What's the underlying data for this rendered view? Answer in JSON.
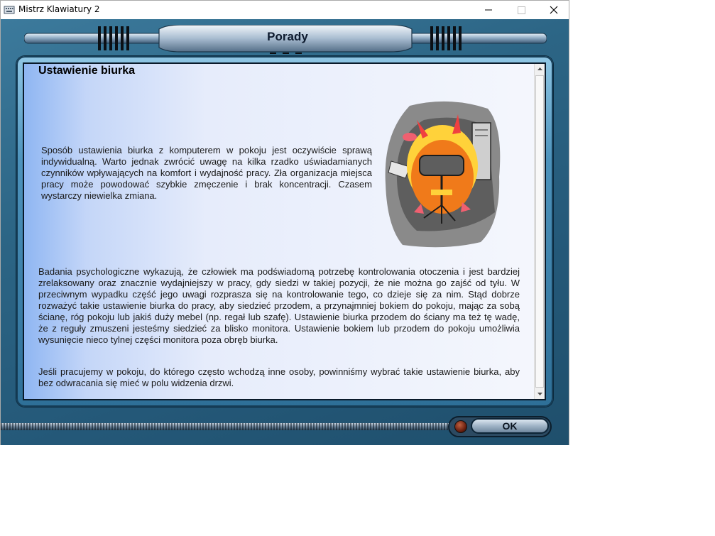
{
  "window": {
    "title": "Mistrz Klawiatury 2"
  },
  "header": {
    "title": "Porady"
  },
  "article": {
    "heading": "Ustawienie biurka",
    "paragraphs": [
      "Sposób ustawienia biurka z komputerem w pokoju jest oczywiście sprawą indywidualną. Warto jednak zwrócić uwagę na kilka rzadko uświadamianych czynników wpływających na komfort i wydajność pracy. Zła organizacja miejsca pracy może powodować szybkie zmęczenie i brak koncentracji. Czasem wystarczy niewielka zmiana.",
      "Badania psychologiczne wykazują, że człowiek ma podświadomą potrzebę kontrolowania otoczenia i jest bardziej zrelaksowany oraz znacznie wydajniejszy w pracy, gdy siedzi w takiej pozycji, że nie można go zajść od tyłu. W przeciwnym wypadku część jego uwagi rozprasza się na kontrolowanie tego, co dzieje się za nim. Stąd dobrze rozważyć takie ustawienie biurka do pracy, aby siedzieć przodem, a przynajmniej bokiem do pokoju, mając za sobą ścianę, róg pokoju lub jakiś duży mebel (np. regał lub szafę). Ustawienie biurka przodem do ściany ma też tę wadę, że z reguły zmuszeni jesteśmy siedzieć za blisko monitora. Ustawienie bokiem lub przodem do pokoju umożliwia wysunięcie nieco tylnej części monitora poza obręb biurka.",
      "Jeśli pracujemy w pokoju, do którego często wchodzą inne osoby, powinniśmy wybrać takie ustawienie biurka, aby bez odwracania się mieć w polu widzenia drzwi."
    ]
  },
  "buttons": {
    "ok": "OK"
  },
  "icons": {
    "app": "keyboard-app-icon",
    "minimize": "minimize-icon",
    "maximize": "maximize-icon",
    "close": "close-icon",
    "scroll_up": "arrow-up-icon",
    "scroll_down": "arrow-down-icon",
    "indicator": "led-indicator-icon"
  },
  "colors": {
    "background": "#2c6585",
    "panel_text": "#1a1a1a",
    "illustration_orange": "#f07a1a"
  }
}
